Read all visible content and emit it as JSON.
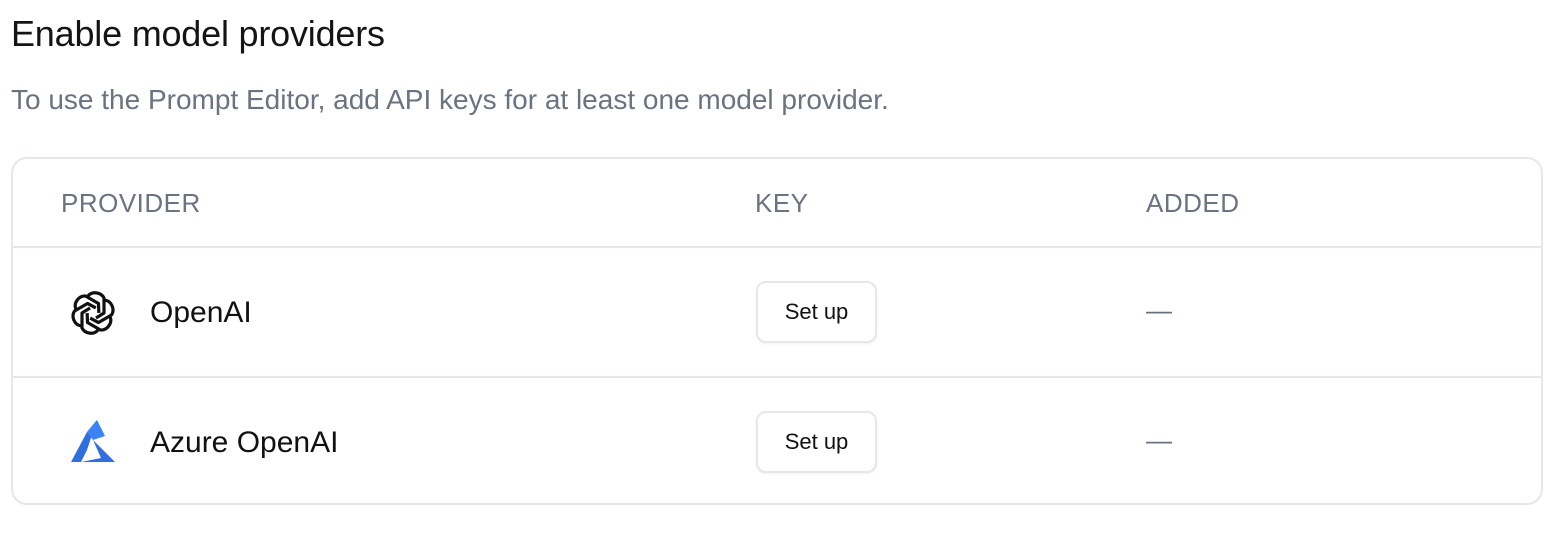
{
  "header": {
    "title": "Enable model providers",
    "subtitle": "To use the Prompt Editor, add API keys for at least one model provider."
  },
  "table": {
    "columns": [
      "PROVIDER",
      "KEY",
      "ADDED"
    ],
    "rows": [
      {
        "provider": "OpenAI",
        "icon": "openai-logo-icon",
        "key_action": "Set up",
        "added": "—"
      },
      {
        "provider": "Azure OpenAI",
        "icon": "azure-logo-icon",
        "key_action": "Set up",
        "added": "—"
      }
    ]
  },
  "colors": {
    "azure_blue": "#2f6fde",
    "muted_text": "#6b7280",
    "border": "#e5e7eb"
  }
}
